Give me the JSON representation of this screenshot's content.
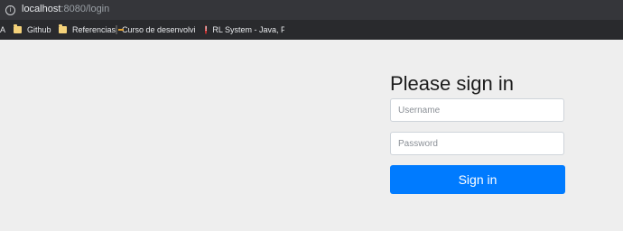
{
  "browser": {
    "url_host": "localhost",
    "url_rest": ":8080/login"
  },
  "bookmarks": [
    {
      "label": "A",
      "icon": "none"
    },
    {
      "label": "Github",
      "icon": "folder-icon"
    },
    {
      "label": "Referencias",
      "icon": "folder-icon"
    },
    {
      "label": "Curso de desenvolvim",
      "icon": "site-icon"
    },
    {
      "label": "RL System - Java, PHP",
      "icon": "warning-icon"
    }
  ],
  "login": {
    "title": "Please sign in",
    "username_placeholder": "Username",
    "password_placeholder": "Password",
    "submit_label": "Sign in"
  },
  "colors": {
    "page_background": "#eeeeee",
    "button_primary": "#007bff",
    "toolbar": "#35363a",
    "bookmarks_bar": "#292a2d"
  }
}
